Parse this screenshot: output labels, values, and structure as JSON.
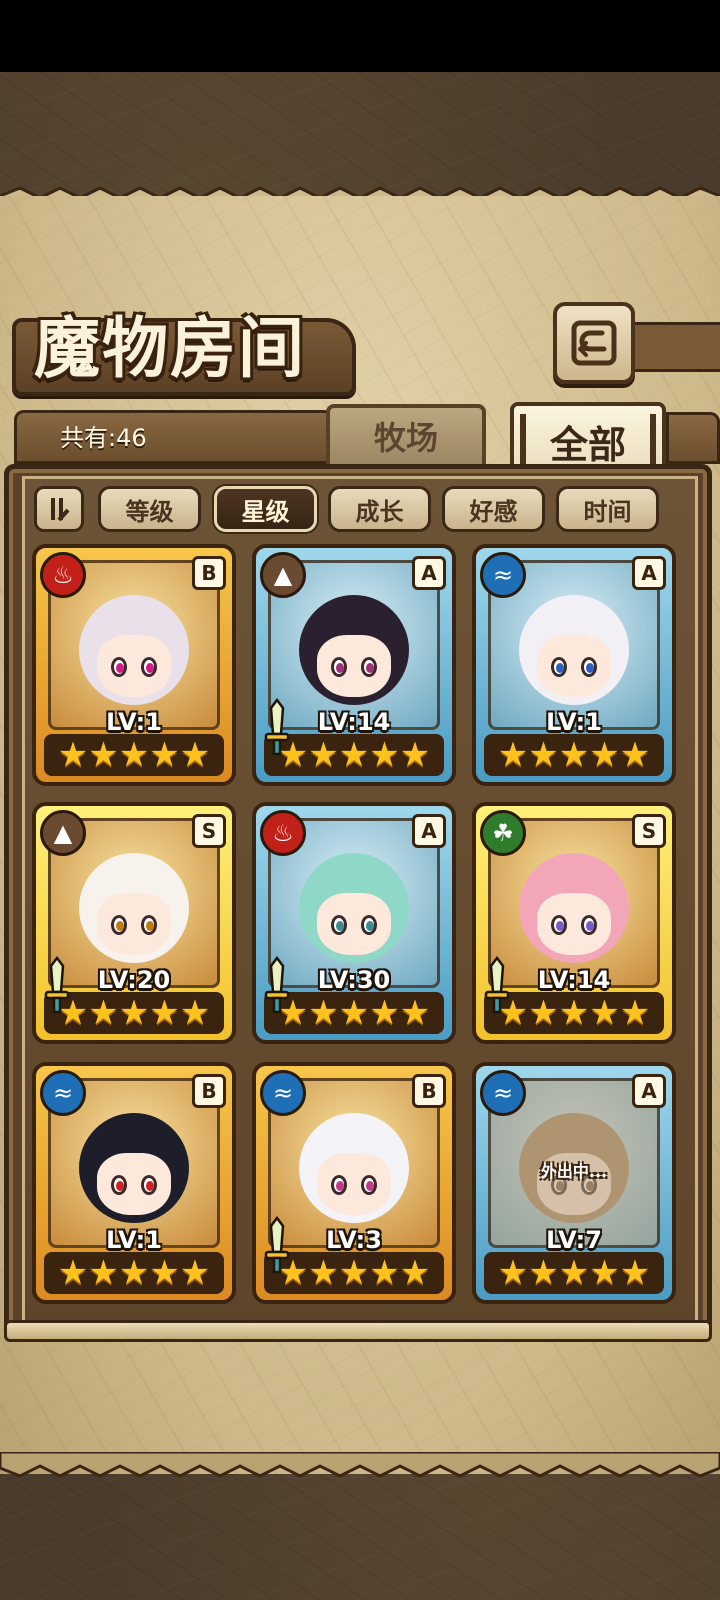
{
  "screen": {
    "title": "魔物房间",
    "count_text": "共有:46",
    "tabs": {
      "farm": "牧场",
      "all": "全部"
    },
    "sort_buttons": [
      "等级",
      "星级",
      "成长",
      "好感",
      "时间"
    ],
    "active_sort": "星级"
  },
  "colors": {
    "fire": "#c2211a",
    "earth": "#6b4a32",
    "water": "#1e6fb5",
    "wood": "#2f7d2c",
    "star": "#ffc21c"
  },
  "monsters": [
    {
      "element": "fire",
      "element_icon": "fire-icon",
      "rank": "B",
      "level": "LV:1",
      "stars": "★★★★★",
      "frame": "gold",
      "eye": "#d01a8c",
      "hair": "#e9e0ea",
      "weapon": false
    },
    {
      "element": "earth",
      "element_icon": "mountain-icon",
      "rank": "A",
      "level": "LV:14",
      "stars": "★★★★★",
      "frame": "blue",
      "eye": "#a0307a",
      "hair": "#2a2030",
      "weapon": true
    },
    {
      "element": "water",
      "element_icon": "water-icon",
      "rank": "A",
      "level": "LV:1",
      "stars": "★★★★★",
      "frame": "blue",
      "eye": "#2a5fc0",
      "hair": "#f3f0f5",
      "weapon": false
    },
    {
      "element": "earth",
      "element_icon": "mountain-icon",
      "rank": "S",
      "level": "LV:20",
      "stars": "★★★★★",
      "frame": "gold s",
      "eye": "#c07a10",
      "hair": "#f7f2ec",
      "weapon": true
    },
    {
      "element": "fire",
      "element_icon": "fire-icon",
      "rank": "A",
      "level": "LV:30",
      "stars": "★★★★★",
      "frame": "blue",
      "eye": "#3a8a90",
      "hair": "#8fd8c8",
      "weapon": true
    },
    {
      "element": "wood",
      "element_icon": "leaf-icon",
      "rank": "S",
      "level": "LV:14",
      "stars": "★★★★★",
      "frame": "gold s",
      "eye": "#7a5ac8",
      "hair": "#f2a6b8",
      "weapon": true
    },
    {
      "element": "water",
      "element_icon": "water-icon",
      "rank": "B",
      "level": "LV:1",
      "stars": "★★★★★",
      "frame": "gold",
      "eye": "#d02020",
      "hair": "#1e1e2a",
      "weapon": false
    },
    {
      "element": "water",
      "element_icon": "water-icon",
      "rank": "B",
      "level": "LV:3",
      "stars": "★★★★★",
      "frame": "gold",
      "eye": "#c03a8a",
      "hair": "#f4f4f8",
      "weapon": true
    },
    {
      "element": "water",
      "element_icon": "water-icon",
      "rank": "A",
      "level": "LV:7",
      "stars": "★★★★★",
      "frame": "blue",
      "eye": "#7a5a3a",
      "hair": "#a8865e",
      "weapon": false,
      "away": "外出中..."
    }
  ]
}
